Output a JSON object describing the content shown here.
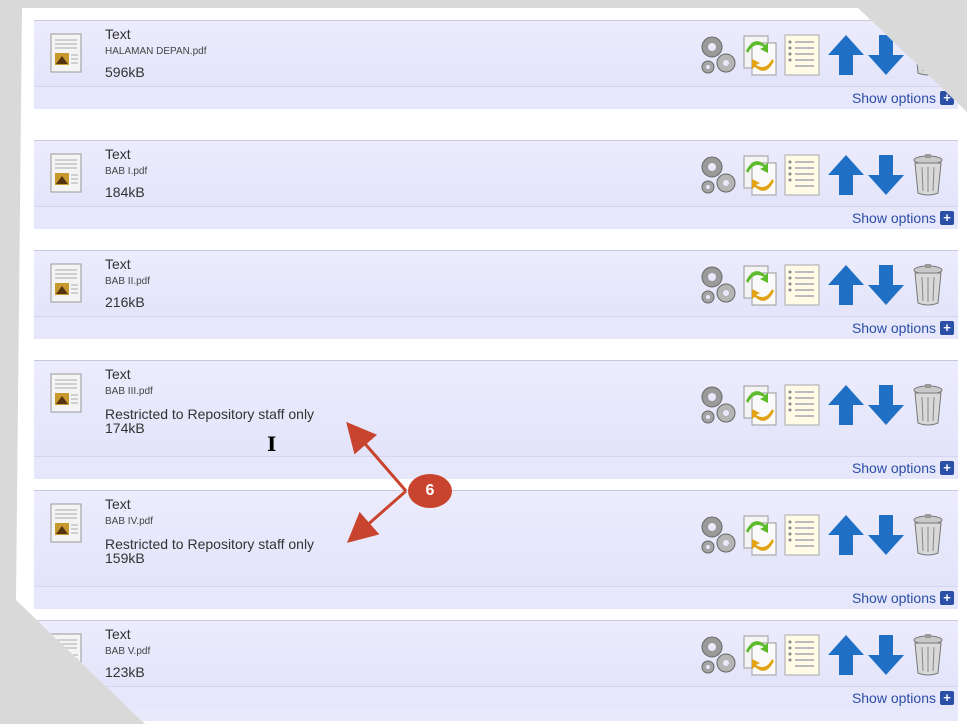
{
  "documents": [
    {
      "title": "Text",
      "filename": "HALAMAN DEPAN.pdf",
      "restriction": "",
      "size": "596kB",
      "show_options": "Show options"
    },
    {
      "title": "Text",
      "filename": "BAB I.pdf",
      "restriction": "",
      "size": "184kB",
      "show_options": "Show options"
    },
    {
      "title": "Text",
      "filename": "BAB II.pdf",
      "restriction": "",
      "size": "216kB",
      "show_options": "Show options"
    },
    {
      "title": "Text",
      "filename": "BAB III.pdf",
      "restriction": "Restricted to Repository staff only",
      "size": "174kB",
      "show_options": "Show options"
    },
    {
      "title": "Text",
      "filename": "BAB IV.pdf",
      "restriction": "Restricted to Repository staff only",
      "size": "159kB",
      "show_options": "Show options"
    },
    {
      "title": "Text",
      "filename": "BAB V.pdf",
      "restriction": "",
      "size": "123kB",
      "show_options": "Show options"
    }
  ],
  "actions": {
    "icons": [
      "gear-icon",
      "replace-icon",
      "list-icon",
      "arrow-up-icon",
      "arrow-down-icon",
      "trash-icon"
    ],
    "plus_symbol": "+"
  },
  "callout": {
    "number": "6",
    "color": "#c9442e"
  },
  "colors": {
    "panel": "#e8e9fb",
    "link": "#2b4ea6",
    "arrow": "#1f6fc5"
  }
}
